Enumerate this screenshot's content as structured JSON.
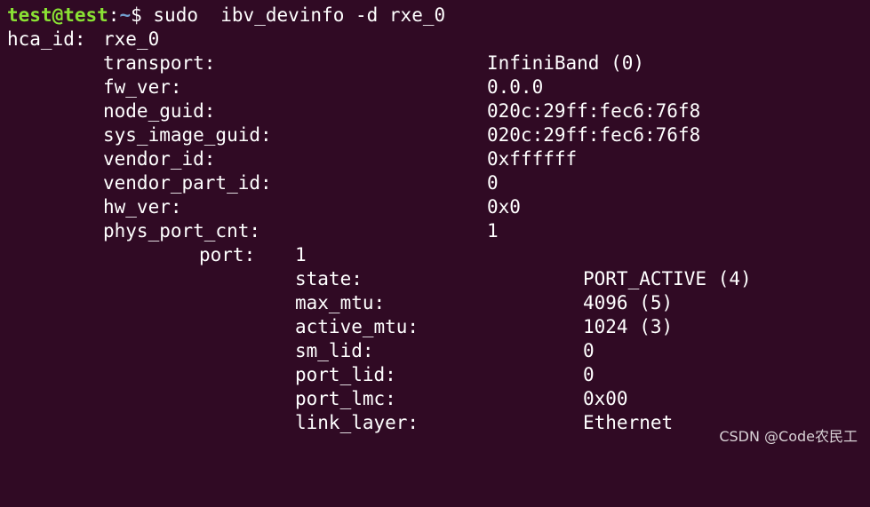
{
  "terminal": {
    "prompt": {
      "user_host": "test@test",
      "separator": ":",
      "path": "~",
      "symbol": "$",
      "command": " sudo  ibv_devinfo -d rxe_0"
    },
    "hca": {
      "label": "hca_id:",
      "value": "rxe_0"
    },
    "fields": [
      {
        "key": "transport:",
        "value": "InfiniBand (0)"
      },
      {
        "key": "fw_ver:",
        "value": "0.0.0"
      },
      {
        "key": "node_guid:",
        "value": "020c:29ff:fec6:76f8"
      },
      {
        "key": "sys_image_guid:",
        "value": "020c:29ff:fec6:76f8"
      },
      {
        "key": "vendor_id:",
        "value": "0xffffff"
      },
      {
        "key": "vendor_part_id:",
        "value": "0"
      },
      {
        "key": "hw_ver:",
        "value": "0x0"
      },
      {
        "key": "phys_port_cnt:",
        "value": "1"
      }
    ],
    "port": {
      "label": "port:",
      "value": "1"
    },
    "port_fields": [
      {
        "key": "state:",
        "value": "PORT_ACTIVE (4)"
      },
      {
        "key": "max_mtu:",
        "value": "4096 (5)"
      },
      {
        "key": "active_mtu:",
        "value": "1024 (3)"
      },
      {
        "key": "sm_lid:",
        "value": "0"
      },
      {
        "key": "port_lid:",
        "value": "0"
      },
      {
        "key": "port_lmc:",
        "value": "0x00"
      },
      {
        "key": "link_layer:",
        "value": "Ethernet"
      }
    ],
    "colors": {
      "background": "#300a24",
      "text": "#ffffff",
      "prompt_user": "#8ae234",
      "prompt_path": "#729fcf"
    }
  },
  "watermark": "CSDN @Code农民工"
}
